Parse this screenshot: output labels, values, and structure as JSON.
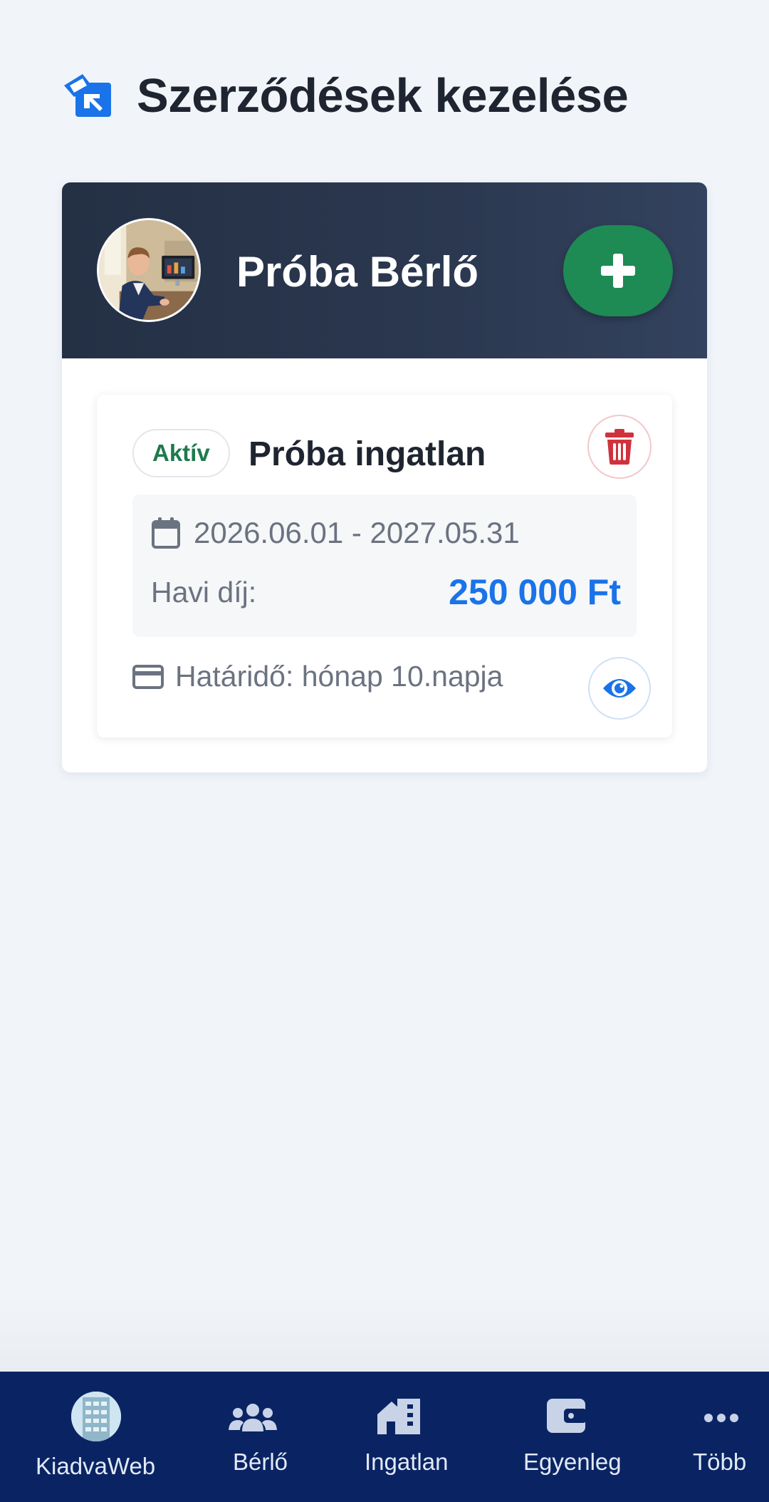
{
  "page": {
    "title": "Szerződések kezelése",
    "header_icon": "contract-sign-icon"
  },
  "tenant": {
    "name": "Próba Bérlő",
    "add_label": "+"
  },
  "contract": {
    "status": "Aktív",
    "property_name": "Próba ingatlan",
    "date_range": "2026.06.01 - 2027.05.31",
    "fee_label": "Havi díj:",
    "fee_value": "250 000 Ft",
    "deadline": "Határidő: hónap 10.napja"
  },
  "nav": {
    "items": [
      {
        "label": "KiadvaWeb",
        "icon": "app-logo"
      },
      {
        "label": "Bérlő",
        "icon": "users-icon"
      },
      {
        "label": "Ingatlan",
        "icon": "building-icon"
      },
      {
        "label": "Egyenleg",
        "icon": "wallet-icon"
      },
      {
        "label": "Több",
        "icon": "more-icon"
      }
    ]
  },
  "colors": {
    "accent_blue": "#1a73e8",
    "add_green": "#1e8a54",
    "delete_red": "#d0323d",
    "nav_bg": "#0a2463",
    "header_dark": "#243044"
  }
}
